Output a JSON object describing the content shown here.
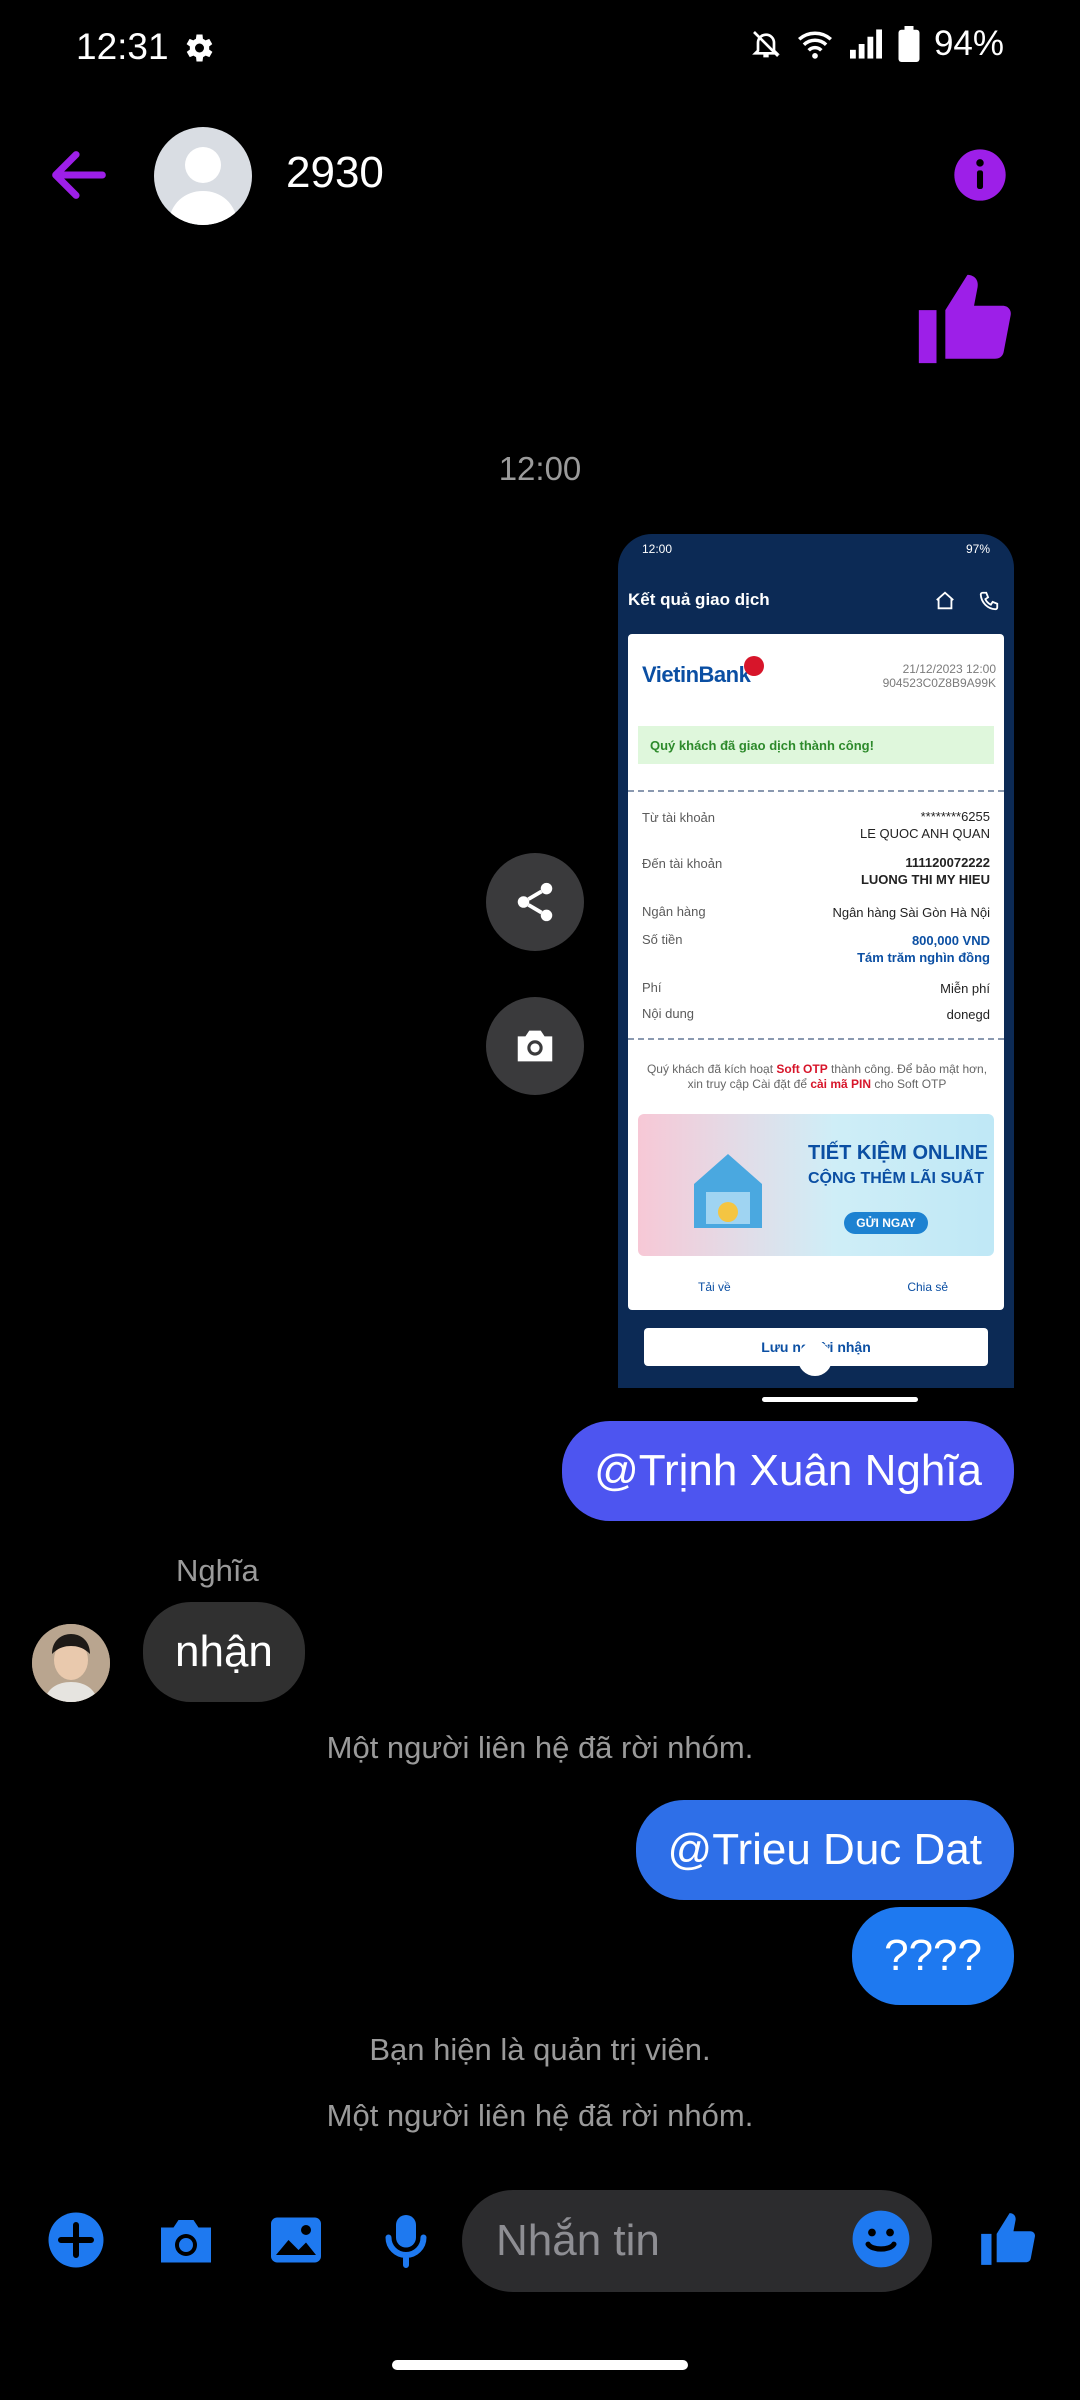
{
  "status_bar": {
    "time": "12:31",
    "battery": "94%"
  },
  "header": {
    "title": "2930"
  },
  "time_separator": "12:00",
  "receipt": {
    "status_time": "12:00",
    "status_battery": "97%",
    "title": "Kết quả giao dịch",
    "bank_logo": "VietinBank",
    "date": "21/12/2023 12:00",
    "code": "904523C0Z8B9A99K",
    "success": "Quý khách đã giao dịch thành công!",
    "rows": [
      {
        "label": "Từ tài khoản",
        "value1": "********6255",
        "value2": "LE QUOC ANH QUAN"
      },
      {
        "label": "Đến tài khoản",
        "value1": "111120072222",
        "value2": "LUONG THI MY HIEU"
      },
      {
        "label": "Ngân hàng",
        "value1": "Ngân hàng Sài Gòn Hà Nội"
      },
      {
        "label": "Số tiền",
        "value1": "800,000 VND",
        "value2": "Tám trăm nghìn đồng"
      },
      {
        "label": "Phí",
        "value1": "Miễn phí"
      },
      {
        "label": "Nội dung",
        "value1": "donegd"
      }
    ],
    "note_pre": "Quý khách đã kích hoạt ",
    "note_hl1": "Soft OTP",
    "note_mid": " thành công. Để bảo mật hơn, xin truy cập Cài đặt để ",
    "note_hl2": "cài mã PIN",
    "note_post": " cho Soft OTP",
    "banner_t1": "TIẾT KIỆM ONLINE",
    "banner_t2": "CỘNG THÊM LÃI SUẤT",
    "banner_btn": "GỬI NGAY",
    "download": "Tải về",
    "share": "Chia sẻ",
    "save": "Lưu người nhận"
  },
  "messages": {
    "m1": "@Trịnh Xuân Nghĩa",
    "sender": "Nghĩa",
    "m2": "nhận",
    "sys1": "Một người liên hệ đã rời nhóm.",
    "m3": "@Trieu Duc Dat",
    "m4": "????",
    "sys2": "Bạn hiện là quản trị viên.",
    "sys3": "Một người liên hệ đã rời nhóm."
  },
  "input": {
    "placeholder": "Nhắn tin"
  },
  "colors": {
    "accent_purple": "#9d1fe8",
    "accent_blue": "#1e79f0",
    "bubble_purple": "#4d55f0"
  }
}
